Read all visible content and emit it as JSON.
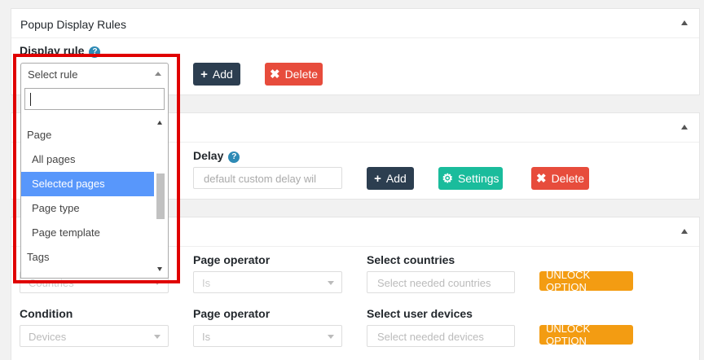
{
  "panel1": {
    "title": "Popup Display Rules",
    "display_rule_label": "Display rule",
    "help": "?",
    "select_placeholder": "Select rule",
    "add_label": "Add",
    "delete_label": "Delete"
  },
  "dropdown": {
    "search_value": "",
    "items": [
      {
        "type": "group",
        "label": "Page"
      },
      {
        "type": "option",
        "label": "All pages"
      },
      {
        "type": "option",
        "label": "Selected pages",
        "selected": true
      },
      {
        "type": "option",
        "label": "Page type"
      },
      {
        "type": "option",
        "label": "Page template"
      },
      {
        "type": "group",
        "label": "Tags"
      }
    ]
  },
  "panel2": {
    "delay_label": "Delay",
    "delay_placeholder": "default custom delay wil",
    "add_label": "Add",
    "settings_label": "Settings",
    "delete_label": "Delete"
  },
  "panel3": {
    "row1": {
      "countries_select": "Countries",
      "page_operator_label": "Page operator",
      "page_operator_value": "Is",
      "select_countries_label": "Select countries",
      "select_countries_placeholder": "Select needed countries",
      "unlock_label": "UNLOCK OPTION"
    },
    "row2": {
      "condition_label": "Condition",
      "devices_select": "Devices",
      "page_operator_label": "Page operator",
      "page_operator_value": "Is",
      "select_devices_label": "Select user devices",
      "select_devices_placeholder": "Select needed devices",
      "unlock_label": "UNLOCK OPTION"
    }
  },
  "colors": {
    "dark_button": "#2c3e50",
    "red_button": "#e74c3c",
    "teal_button": "#1abc9c",
    "orange_button": "#f39c12",
    "selected_option": "#5897fb",
    "highlight_box": "#e00000"
  }
}
